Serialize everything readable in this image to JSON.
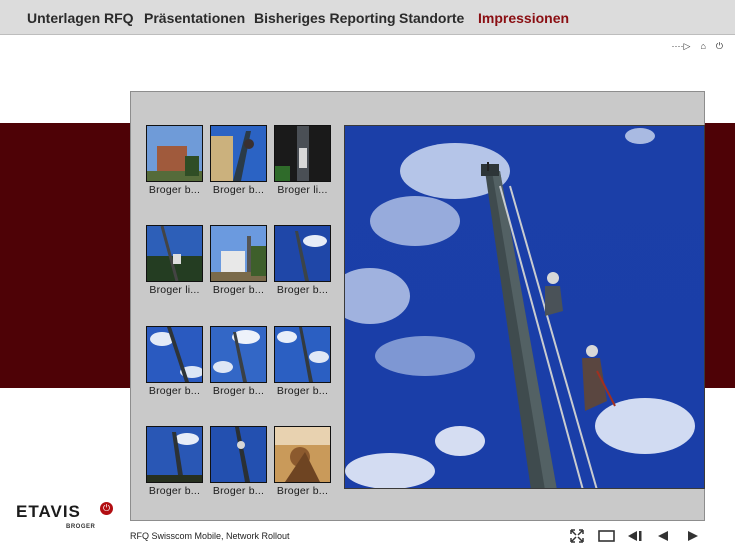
{
  "nav": {
    "items": [
      "Unterlagen RFQ",
      "Präsentationen",
      "Bisheriges Reporting",
      "Standorte",
      "Impressionen"
    ],
    "active_index": 4,
    "active_color": "#8a0e12"
  },
  "utility_icons": [
    "more-dots-icon",
    "home-icon",
    "power-icon"
  ],
  "gallery": {
    "thumbnails": [
      {
        "caption": "Broger b..."
      },
      {
        "caption": "Broger b..."
      },
      {
        "caption": "Broger li..."
      },
      {
        "caption": "Broger li..."
      },
      {
        "caption": "Broger b..."
      },
      {
        "caption": "Broger b..."
      },
      {
        "caption": "Broger b..."
      },
      {
        "caption": "Broger b..."
      },
      {
        "caption": "Broger b..."
      },
      {
        "caption": "Broger b..."
      },
      {
        "caption": "Broger b..."
      },
      {
        "caption": "Broger b..."
      }
    ]
  },
  "footer": {
    "logo_text": "ETAVIS",
    "logo_sub": "BROGER",
    "caption": "RFQ Swisscom Mobile, Network Rollout",
    "controls": [
      "fullscreen-icon",
      "window-icon",
      "first-icon",
      "previous-icon",
      "next-icon"
    ]
  },
  "colors": {
    "band": "#4e0206",
    "panel": "#c9c9c9",
    "nav_bg": "#dcdcdc",
    "logo_power": "#b20e12"
  }
}
